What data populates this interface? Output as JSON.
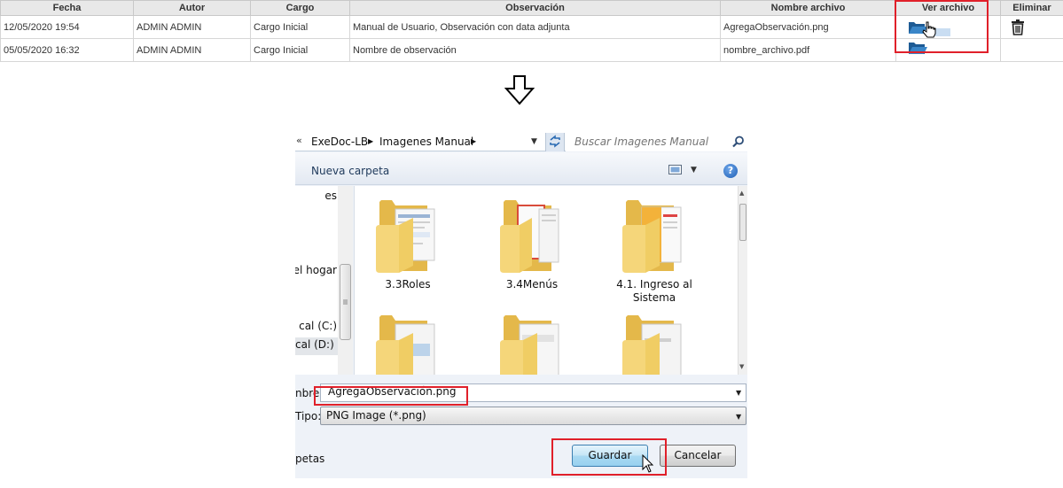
{
  "table": {
    "headers": [
      "Fecha",
      "Autor",
      "Cargo",
      "Observación",
      "Nombre archivo",
      "Ver archivo",
      "Eliminar"
    ],
    "rows": [
      {
        "fecha": "12/05/2020 19:54",
        "autor": "ADMIN ADMIN",
        "cargo": "Cargo Inicial",
        "observacion": "Manual de Usuario, Observación con data adjunta",
        "archivo": "AgregaObservación.png"
      },
      {
        "fecha": "05/05/2020 16:32",
        "autor": "ADMIN ADMIN",
        "cargo": "Cargo Inicial",
        "observacion": "Nombre de observación",
        "archivo": "nombre_archivo.pdf"
      }
    ]
  },
  "dialog": {
    "breadcrumb": [
      "ExeDoc-LB",
      "Imagenes Manual"
    ],
    "search_placeholder": "Buscar Imagenes Manual",
    "new_folder": "Nueva carpeta",
    "help": "?",
    "nav_items": [
      "es",
      "el hogar",
      "cal (C:)",
      "cal (D:)"
    ],
    "files": [
      {
        "label": "3.3Roles"
      },
      {
        "label": "3.4Menús"
      },
      {
        "label": "4.1. Ingreso al Sistema"
      }
    ],
    "filename_label": "nbre:",
    "filename_value": "AgregaObservación.png",
    "filetype_label": "Tipo:",
    "filetype_value": "PNG Image (*.png)",
    "hide_folders": "petas",
    "save_label": "Guardar",
    "cancel_label": "Cancelar"
  },
  "colors": {
    "annotation_red": "#e0202a",
    "header_gray": "#e8e8e8",
    "folder_blue": "#1d5b95",
    "folder_yellow": "#f5d67a"
  }
}
